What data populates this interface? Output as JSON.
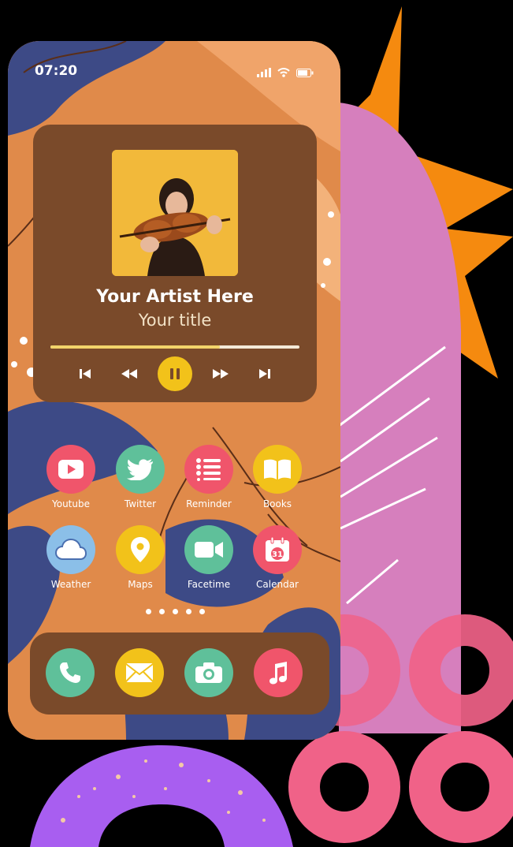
{
  "status_bar": {
    "time": "07:20"
  },
  "music_widget": {
    "artist": "Your Artist Here",
    "title": "Your title",
    "progress": 0.68
  },
  "apps": [
    {
      "label": "Youtube",
      "icon": "youtube-icon",
      "color": "#f0556b"
    },
    {
      "label": "Twitter",
      "icon": "twitter-icon",
      "color": "#5fc09a"
    },
    {
      "label": "Reminder",
      "icon": "list-icon",
      "color": "#f0556b"
    },
    {
      "label": "Books",
      "icon": "book-icon",
      "color": "#f2c21a"
    },
    {
      "label": "Weather",
      "icon": "cloud-icon",
      "color": "#8bbfe8"
    },
    {
      "label": "Maps",
      "icon": "map-pin-icon",
      "color": "#f2c21a"
    },
    {
      "label": "Facetime",
      "icon": "video-camera-icon",
      "color": "#5fc09a"
    },
    {
      "label": "Calendar",
      "icon": "calendar-icon",
      "color": "#f0556b",
      "badge": "31"
    }
  ],
  "dock": [
    {
      "icon": "phone-icon",
      "color": "#5fc09a"
    },
    {
      "icon": "mail-icon",
      "color": "#f2c21a"
    },
    {
      "icon": "camera-icon",
      "color": "#5fc09a"
    },
    {
      "icon": "music-note-icon",
      "color": "#f0556b"
    }
  ],
  "colors": {
    "widget_bg": "#7a4a2a",
    "accent_yellow": "#f2c21a",
    "wallpaper_orange": "#e08a4a",
    "wallpaper_navy": "#3d4a86"
  }
}
